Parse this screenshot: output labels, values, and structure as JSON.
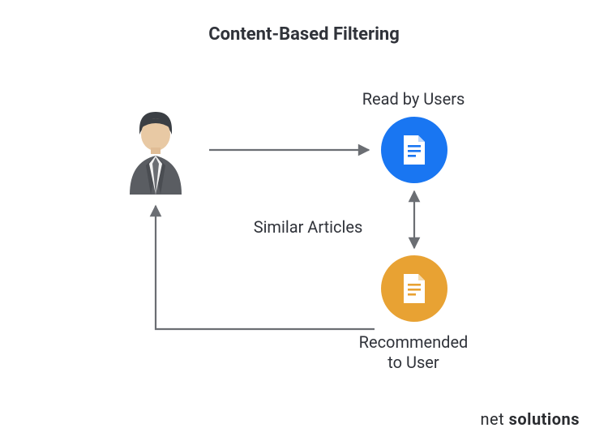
{
  "title": "Content-Based Filtering",
  "labels": {
    "read_by_users": "Read by Users",
    "similar_articles": "Similar Articles",
    "recommended_to_user": "Recommended\nto User"
  },
  "nodes": {
    "user_icon": "user-avatar",
    "doc_blue": "document-icon",
    "doc_orange": "document-icon"
  },
  "colors": {
    "blue": "#1976f2",
    "orange": "#e8a233",
    "text": "#30333a",
    "arrow": "#6b6e73"
  },
  "brand": {
    "part1": "net ",
    "part2": "solutions"
  }
}
